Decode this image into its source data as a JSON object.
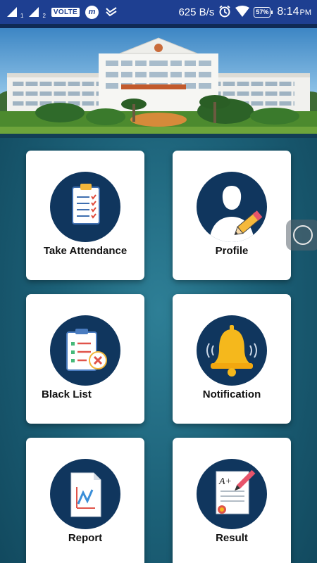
{
  "status_bar": {
    "sim1_label": "1",
    "sim2_label": "2",
    "volte": "VOLTE",
    "app_icon_letter": "m",
    "net_speed": "625 B/s",
    "battery": "57%",
    "time": "8:14",
    "ampm": "PM"
  },
  "tiles": [
    {
      "label": "Take Attendance",
      "icon": "clipboard-checklist-icon"
    },
    {
      "label": "Profile",
      "icon": "user-edit-icon"
    },
    {
      "label": "Black List",
      "icon": "blacklist-document-icon"
    },
    {
      "label": "Notification",
      "icon": "bell-icon"
    },
    {
      "label": "Report",
      "icon": "report-chart-icon"
    },
    {
      "label": "Result",
      "icon": "result-certificate-icon"
    }
  ],
  "colors": {
    "status_bar": "#1e3f91",
    "icon_circle": "#10365e",
    "background": "#1c6178",
    "bell": "#f5b81c"
  }
}
